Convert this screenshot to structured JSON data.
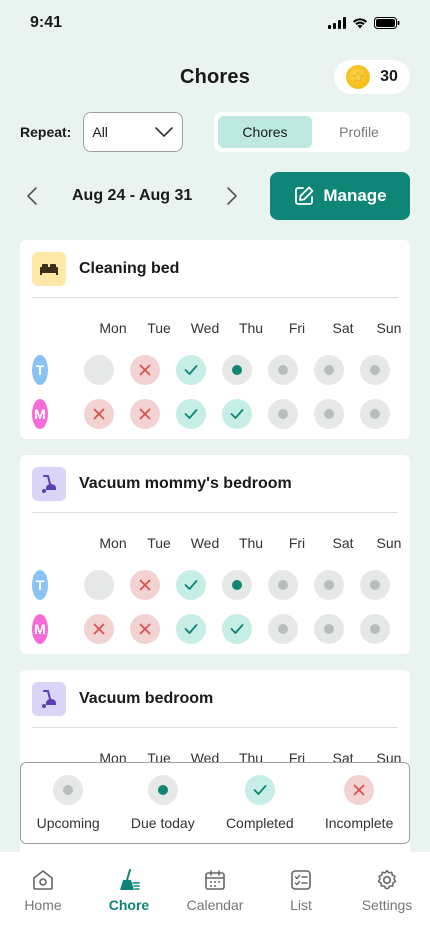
{
  "status_bar": {
    "time": "9:41"
  },
  "header": {
    "title": "Chores",
    "coins": "30"
  },
  "filters": {
    "repeat_label": "Repeat:",
    "repeat_value": "All",
    "segments": [
      {
        "label": "Chores",
        "active": true
      },
      {
        "label": "Profile",
        "active": false
      }
    ]
  },
  "week": {
    "label": "Aug 24 - Aug 31",
    "manage_label": "Manage"
  },
  "days": [
    "Mon",
    "Tue",
    "Wed",
    "Thu",
    "Fri",
    "Sat",
    "Sun"
  ],
  "chores": [
    {
      "title": "Cleaning bed",
      "icon": "bed-icon",
      "icon_bg": "#fde8a7",
      "rows": [
        {
          "initial": "T",
          "color": "#89c3f6",
          "statuses": [
            "empty",
            "incomplete",
            "completed",
            "due",
            "upcoming",
            "upcoming",
            "upcoming"
          ]
        },
        {
          "initial": "M",
          "color": "#f56cd9",
          "statuses": [
            "incomplete",
            "incomplete",
            "completed",
            "completed",
            "upcoming",
            "upcoming",
            "upcoming"
          ]
        }
      ]
    },
    {
      "title": "Vacuum mommy's bedroom",
      "icon": "vacuum-icon",
      "icon_bg": "#dad5f7",
      "rows": [
        {
          "initial": "T",
          "color": "#89c3f6",
          "statuses": [
            "empty",
            "incomplete",
            "completed",
            "due",
            "upcoming",
            "upcoming",
            "upcoming"
          ]
        },
        {
          "initial": "M",
          "color": "#f56cd9",
          "statuses": [
            "incomplete",
            "incomplete",
            "completed",
            "completed",
            "upcoming",
            "upcoming",
            "upcoming"
          ]
        }
      ]
    },
    {
      "title": "Vacuum bedroom",
      "icon": "vacuum-icon",
      "icon_bg": "#dad5f7",
      "rows": []
    }
  ],
  "legend": [
    {
      "label": "Upcoming",
      "status": "upcoming"
    },
    {
      "label": "Due today",
      "status": "due"
    },
    {
      "label": "Completed",
      "status": "completed"
    },
    {
      "label": "Incomplete",
      "status": "incomplete"
    }
  ],
  "tabbar": [
    {
      "label": "Home",
      "icon": "home-icon",
      "active": false
    },
    {
      "label": "Chore",
      "icon": "broom-icon",
      "active": true
    },
    {
      "label": "Calendar",
      "icon": "calendar-icon",
      "active": false
    },
    {
      "label": "List",
      "icon": "list-icon",
      "active": false
    },
    {
      "label": "Settings",
      "icon": "gear-icon",
      "active": false
    }
  ],
  "colors": {
    "accent": "#0f8577",
    "background": "#e9f4f1",
    "completed": "#c6ede6",
    "incomplete": "#f3d2d2"
  }
}
